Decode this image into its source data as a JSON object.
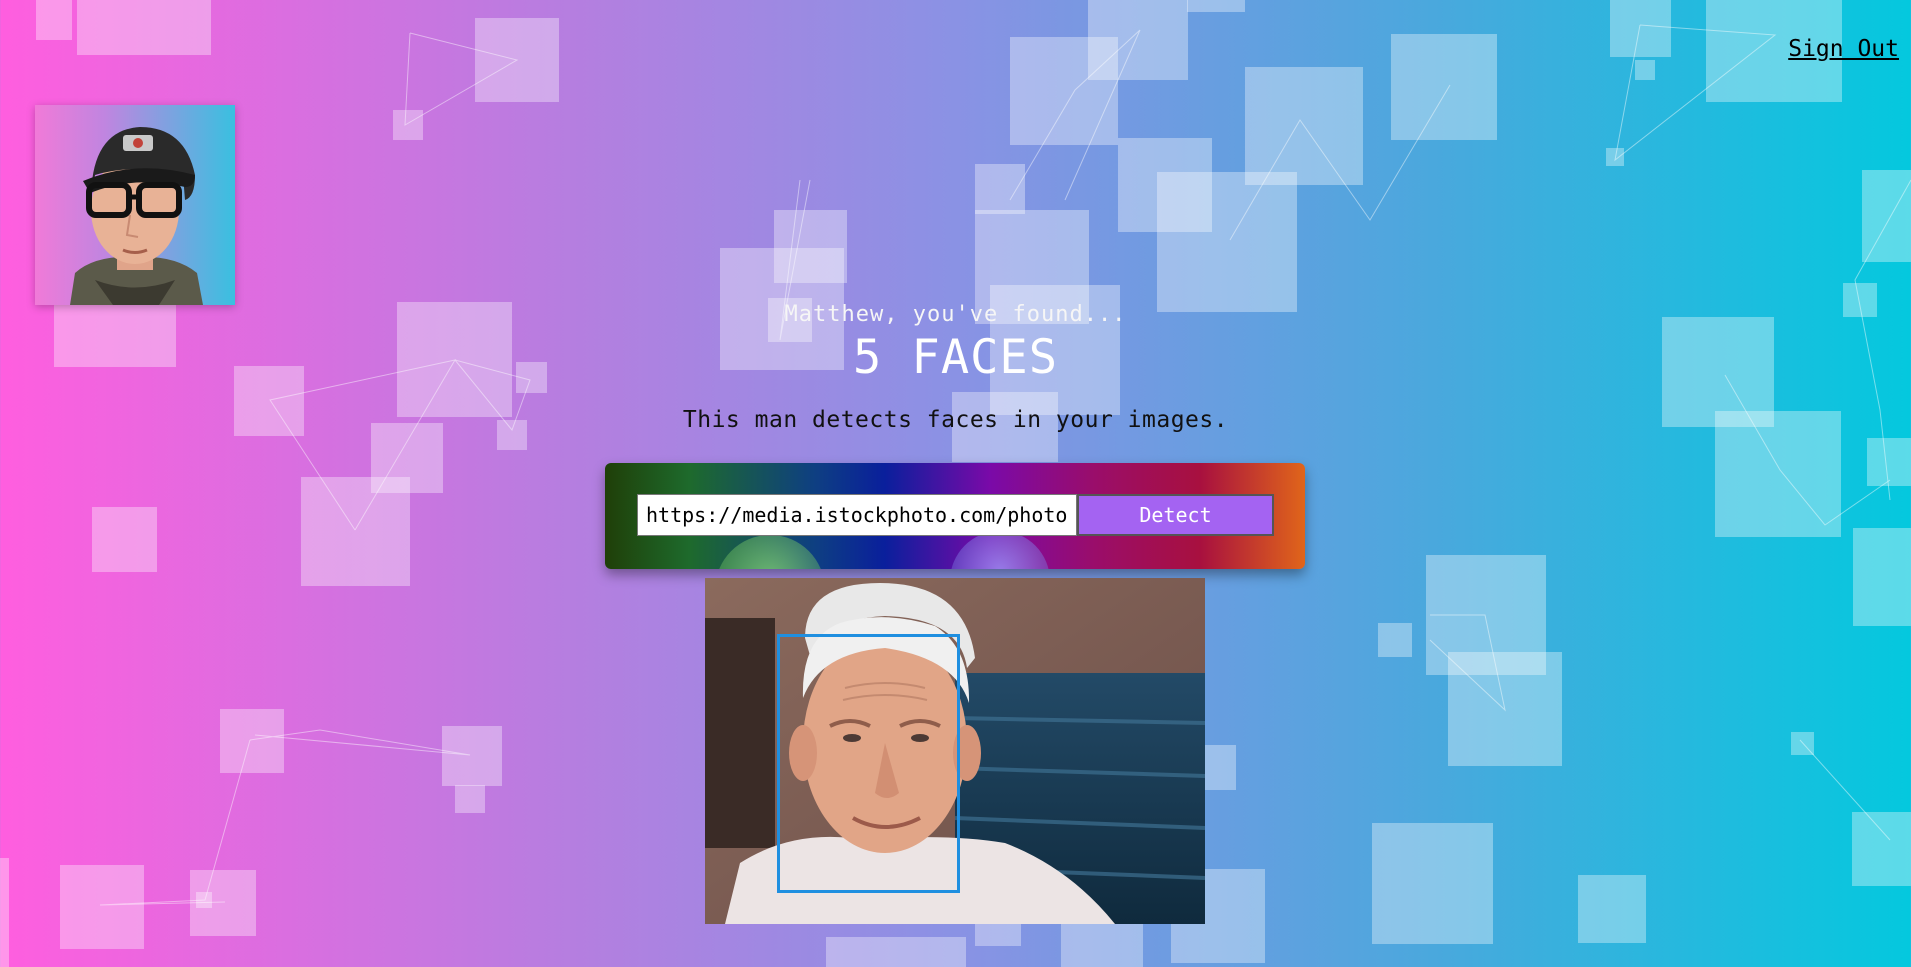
{
  "header": {
    "sign_out_label": "Sign Out"
  },
  "logo": {
    "alt": "Face detection logo"
  },
  "rank": {
    "greeting": "Matthew, you've found...",
    "count": "5 FACES"
  },
  "intro": {
    "text": "This man detects faces in your images."
  },
  "form": {
    "url_value": "https://media.istockphoto.com/photos/",
    "detect_label": "Detect"
  },
  "result": {
    "image_alt": "Elderly man smiling",
    "box_color": "#1f8fe0"
  },
  "colors": {
    "accent": "#a463f2",
    "bg_left": "#ff5edf",
    "bg_right": "#04c8de"
  }
}
